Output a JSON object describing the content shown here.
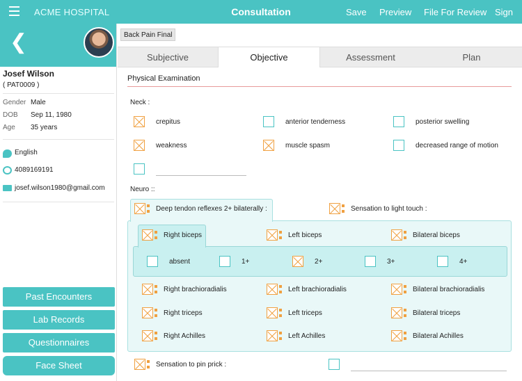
{
  "topbar": {
    "brand": "ACME  HOSPITAL",
    "title": "Consultation",
    "save": "Save",
    "preview": "Preview",
    "file_for_review": "File For Review",
    "sign": "Sign"
  },
  "patient": {
    "name": "Josef Wilson",
    "id": "( PAT0009 )",
    "gender_label": "Gender",
    "gender": "Male",
    "dob_label": "DOB",
    "dob": "Sep 11, 1980",
    "age_label": "Age",
    "age": "35 years",
    "language": "English",
    "phone": "4089169191",
    "email": "josef.wilson1980@gmail.com"
  },
  "sidebar_buttons": [
    "Past Encounters",
    "Lab Records",
    "Questionnaires",
    "Face Sheet"
  ],
  "chip": "Back Pain Final",
  "tabs": [
    "Subjective",
    "Objective",
    "Assessment",
    "Plan"
  ],
  "active_tab": "Objective",
  "section_title": "Physical Examination",
  "neck": {
    "label": "Neck :",
    "items": [
      {
        "label": "crepitus",
        "checked": true
      },
      {
        "label": "anterior tenderness",
        "checked": false
      },
      {
        "label": "posterior swelling",
        "checked": false
      },
      {
        "label": "weakness",
        "checked": true
      },
      {
        "label": "muscle spasm",
        "checked": true
      },
      {
        "label": "decreased range of motion",
        "checked": false
      }
    ]
  },
  "neuro": {
    "label": "Neuro ::",
    "dtr": "Deep tendon reflexes 2+ bilaterally :",
    "light": "Sensation to light touch :",
    "pin": "Sensation to pin prick :",
    "reflexes": [
      "Right biceps",
      "Left biceps",
      "Bilateral biceps",
      "Right brachioradialis",
      "Left brachioradialis",
      "Bilateral brachioradialis",
      "Right triceps",
      "Left triceps",
      "Bilateral triceps",
      "Right Achilles",
      "Left Achilles",
      "Bilateral Achilles"
    ],
    "grades": [
      {
        "label": "absent",
        "checked": false
      },
      {
        "label": "1+",
        "checked": false
      },
      {
        "label": "2+",
        "checked": true
      },
      {
        "label": "3+",
        "checked": false
      },
      {
        "label": "4+",
        "checked": false
      }
    ]
  },
  "colors": {
    "accent": "#4ac3c3",
    "check": "#f0a040",
    "divider": "#e79a9a"
  }
}
